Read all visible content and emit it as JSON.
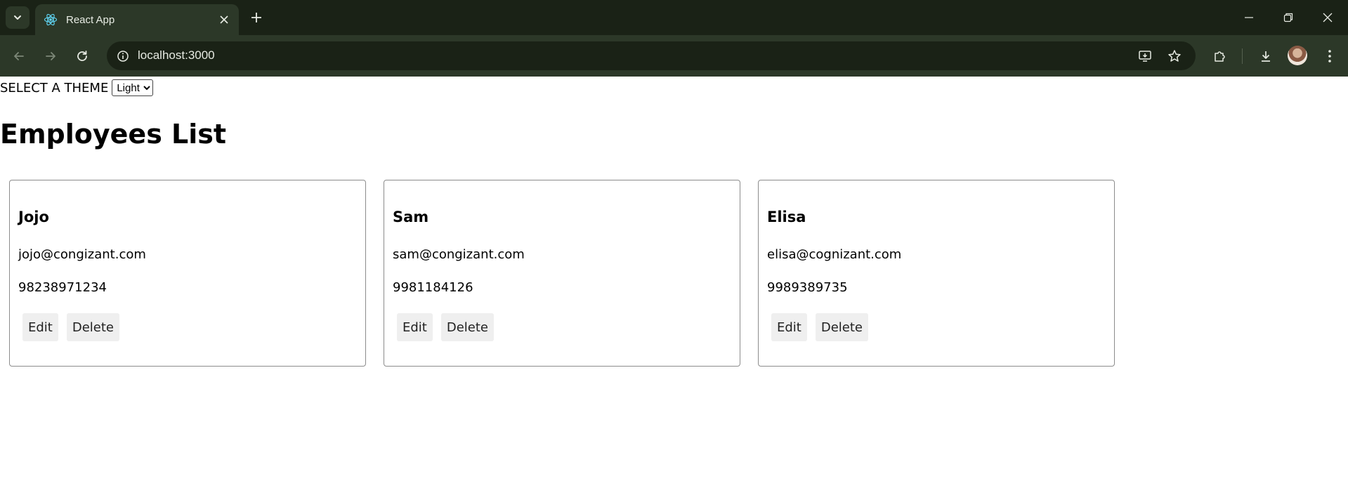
{
  "browser": {
    "tab_title": "React App",
    "url": "localhost:3000",
    "icons": {
      "tab_search": "chevron-down-icon",
      "favicon": "react-logo-icon",
      "tab_close": "close-icon",
      "new_tab": "plus-icon",
      "minimize": "minimize-icon",
      "restore": "restore-icon",
      "close_window": "close-icon",
      "back": "back-arrow-icon",
      "forward": "forward-arrow-icon",
      "reload": "reload-icon",
      "site_info": "info-icon",
      "install_app": "install-app-icon",
      "bookmark": "star-icon",
      "extensions": "puzzle-icon",
      "downloads": "download-icon",
      "profile": "avatar",
      "menu": "kebab-menu-icon"
    }
  },
  "page": {
    "theme_label": "SELECT A THEME",
    "theme_selected": "Light",
    "title": "Employees List",
    "employees": [
      {
        "name": "Jojo",
        "email": "jojo@congizant.com",
        "phone": "98238971234"
      },
      {
        "name": "Sam",
        "email": "sam@congizant.com",
        "phone": "9981184126"
      },
      {
        "name": "Elisa",
        "email": "elisa@cognizant.com",
        "phone": "9989389735"
      }
    ],
    "edit_label": "Edit",
    "delete_label": "Delete"
  },
  "colors": {
    "titlebar_bg": "#1a2216",
    "toolbar_bg": "#2c3828",
    "page_bg": "#ffffff",
    "button_bg": "#efefef",
    "card_border": "#8c8c8c"
  }
}
